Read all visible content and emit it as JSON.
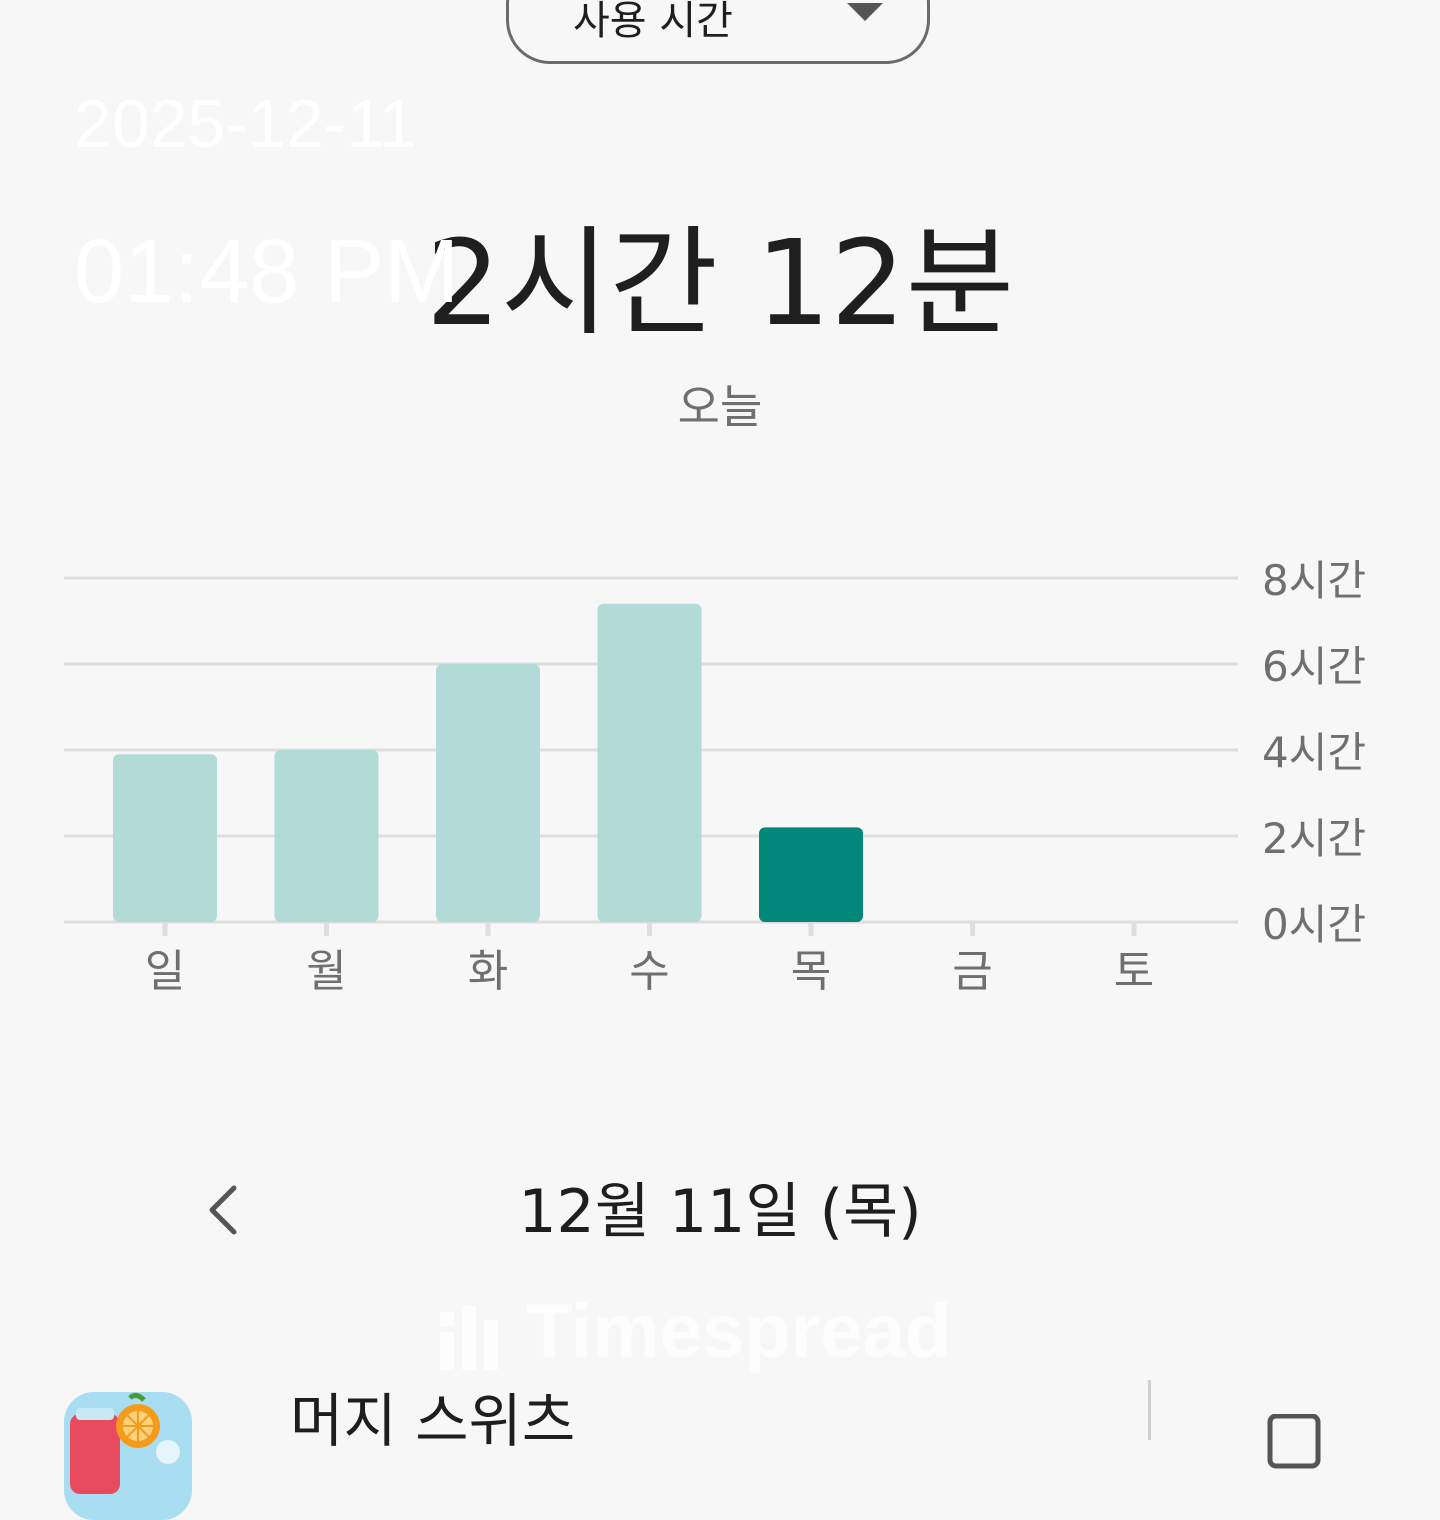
{
  "header": {
    "dropdown_label": "사용 시간",
    "total_time": "2시간 12분",
    "period_label": "오늘"
  },
  "overlay": {
    "date": "2025-12-11",
    "time": "01:48 PM"
  },
  "colors": {
    "bar_default": "#b2dbd8",
    "bar_selected": "#03877a",
    "gridline": "#dedede",
    "axis_text": "#6f6f6f"
  },
  "chart_data": {
    "type": "bar",
    "categories": [
      "일",
      "월",
      "화",
      "수",
      "목",
      "금",
      "토"
    ],
    "values": [
      3.9,
      4.0,
      6.0,
      7.4,
      2.2,
      0,
      0
    ],
    "selected_index": 4,
    "ylim": [
      0,
      8
    ],
    "yticks": [
      0,
      2,
      4,
      6,
      8
    ],
    "ytick_labels": [
      "0시간",
      "2시간",
      "4시간",
      "6시간",
      "8시간"
    ],
    "ytick_position": "right",
    "grid": true,
    "title": "",
    "xlabel": "",
    "ylabel": ""
  },
  "date_nav": {
    "date_label": "12월 11일 (목)",
    "prev_icon": "chevron-left-icon"
  },
  "watermark": {
    "text": "Timespread"
  },
  "app_list": [
    {
      "name": "머지 스위츠",
      "icon": "merge-sweets-app-icon",
      "action_icon": "timer-icon"
    }
  ]
}
